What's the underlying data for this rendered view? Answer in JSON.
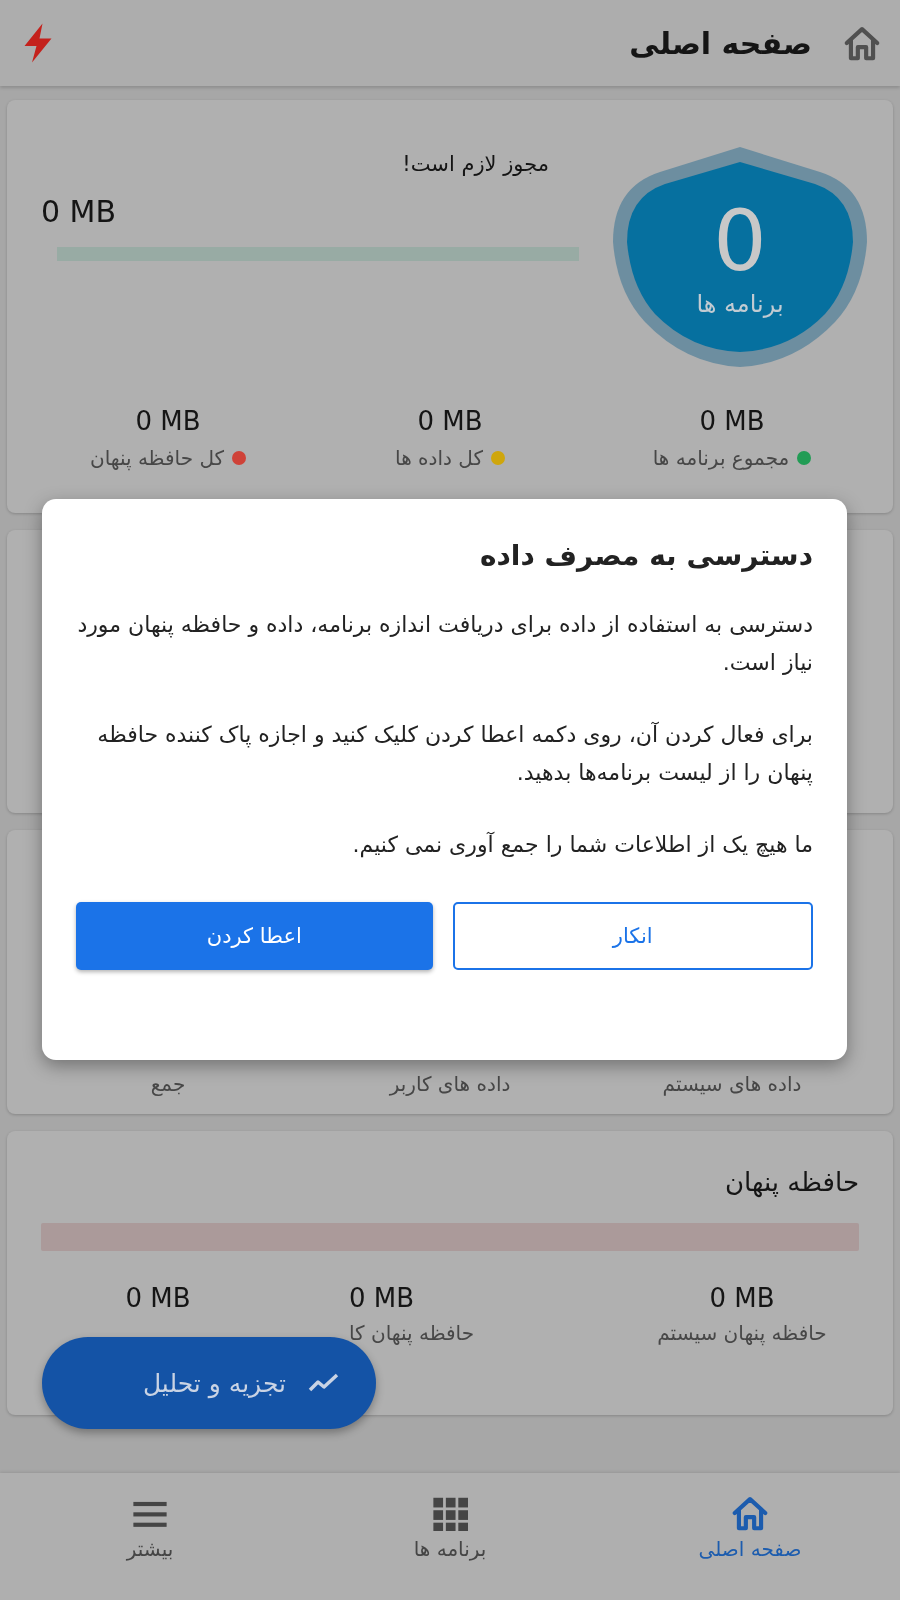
{
  "header": {
    "title": "صفحه اصلی"
  },
  "summary_card": {
    "apps_count": "0",
    "apps_label": "برنامه ها",
    "permission_note": "مجوز لازم است!",
    "total": "0 MB",
    "bar": {
      "level": 0
    },
    "stats": [
      {
        "value": "0 MB",
        "label": "مجموع برنامه ها",
        "color": "#229c55"
      },
      {
        "value": "0 MB",
        "label": "کل داده ها",
        "color": "#cfa60c"
      },
      {
        "value": "0 MB",
        "label": "کل حافظه پنهان",
        "color": "#cf4238"
      }
    ]
  },
  "data_card": {
    "labels": [
      "داده های سیستم",
      "داده های کاربر",
      "جمع"
    ]
  },
  "cache_card": {
    "title": "حافظه پنهان",
    "bar": {
      "level": 0
    },
    "stats": [
      {
        "value": "0 MB",
        "label": "حافظه پنهان سیستم"
      },
      {
        "value": "0 MB",
        "label": "حافظه پنهان کا"
      },
      {
        "value": "0 MB"
      }
    ]
  },
  "fab": {
    "label": "تجزیه و تحلیل"
  },
  "dialog": {
    "title": "دسترسی به مصرف داده",
    "paragraphs": [
      "دسترسی به استفاده از داده برای دریافت اندازه برنامه، داده و حافظه پنهان مورد نیاز است.",
      "برای فعال کردن آن، روی دکمه اعطا کردن کلیک کنید و اجازه پاک کننده حافظه پنهان را از لیست برنامه‌ها بدهید.",
      "ما هیچ یک از اطلاعات شما را جمع آوری نمی کنیم."
    ],
    "buttons": [
      {
        "label": "انکار",
        "kind": "outlined"
      },
      {
        "label": "اعطا کردن",
        "kind": "filled"
      }
    ]
  },
  "bottom_nav": [
    {
      "label": "صفحه اصلی",
      "selected": true
    },
    {
      "label": "برنامه ها",
      "selected": false
    },
    {
      "label": "بیشتر",
      "selected": false
    }
  ]
}
